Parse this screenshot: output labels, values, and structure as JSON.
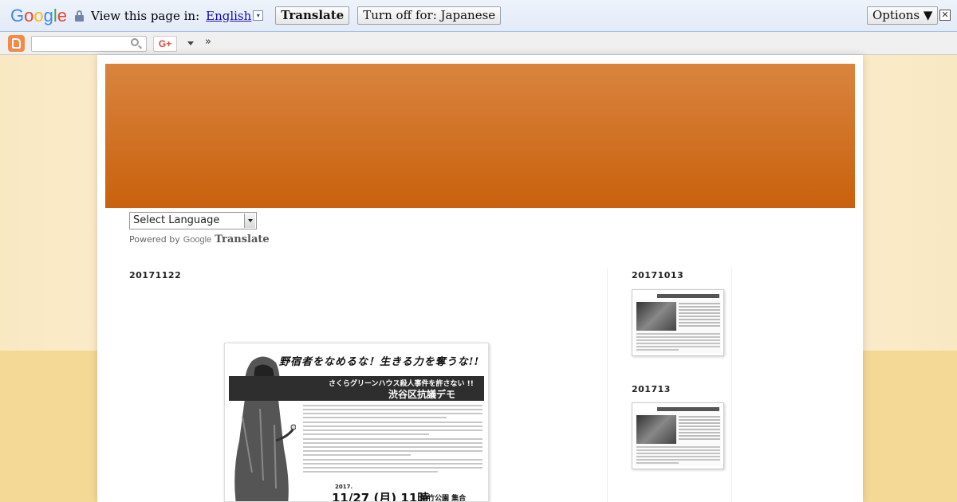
{
  "translate_bar": {
    "logo_letters": [
      {
        "char": "G",
        "color": "#4285f4"
      },
      {
        "char": "o",
        "color": "#ea4335"
      },
      {
        "char": "o",
        "color": "#fbbc05"
      },
      {
        "char": "g",
        "color": "#4285f4"
      },
      {
        "char": "l",
        "color": "#34a853"
      },
      {
        "char": "e",
        "color": "#ea4335"
      }
    ],
    "prompt": "View this page in:",
    "language": "English",
    "language_dropdown_glyph": "▾",
    "translate_label": "Translate",
    "turn_off_label": "Turn off for: Japanese",
    "options_label": "Options ▼",
    "close_glyph": "✕"
  },
  "navbar": {
    "gplus_label": "G+",
    "more_glyph": "»"
  },
  "header": {
    "banner_colors": [
      "#d9843e",
      "#c9610d"
    ]
  },
  "translate_widget": {
    "select_label": "Select Language",
    "powered_by": "Powered by",
    "google_word": "Google",
    "translate_word": "Translate"
  },
  "post": {
    "date": "20171122",
    "flyer": {
      "headline": "野宿者をなめるな！生きる力を奪うな!!",
      "subtitle": "さくらグリーンハウス殺人事件を許さない !!",
      "demo_title": "渋谷区抗議デモ",
      "year": "2017.",
      "date_time": "11/27 (月) 11時",
      "place": "美竹公園 集合"
    }
  },
  "sidebar": {
    "sections": [
      {
        "title": "20171013"
      },
      {
        "title": "201713"
      }
    ]
  }
}
